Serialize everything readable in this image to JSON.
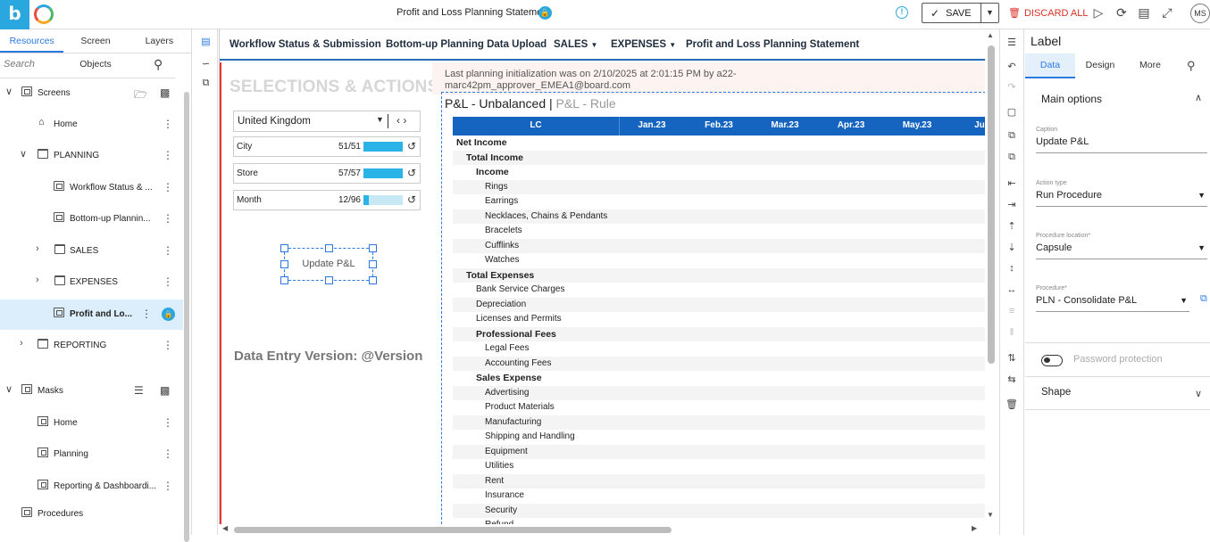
{
  "topbar": {
    "title": "Profit and Loss Planning Statement",
    "save_label": "SAVE",
    "discard_label": "DISCARD ALL",
    "user_initials": "MS",
    "icons": [
      "play-icon",
      "refresh-icon",
      "screen-icon",
      "expand-icon"
    ]
  },
  "left": {
    "tabs": [
      "Resources",
      "Screen Objects",
      "Layers"
    ],
    "search_placeholder": "Search",
    "screens_header": "Screens",
    "tree": [
      {
        "label": "Home",
        "level": 1
      },
      {
        "label": "PLANNING",
        "level": 1
      },
      {
        "label": "Workflow Status & ...",
        "level": 2
      },
      {
        "label": "Bottom-up Plannin...",
        "level": 2
      },
      {
        "label": "SALES",
        "level": 2
      },
      {
        "label": "EXPENSES",
        "level": 2
      },
      {
        "label": "Profit and Lo...",
        "level": 2
      },
      {
        "label": "REPORTING",
        "level": 0
      }
    ],
    "masks_header": "Masks",
    "masks": [
      "Home",
      "Planning",
      "Reporting & Dashboardi..."
    ],
    "procedures": "Procedures"
  },
  "canvas": {
    "menu": [
      "Workflow Status & Submission",
      "Bottom-up Planning Data Upload",
      "SALES",
      "EXPENSES",
      "Profit and Loss Planning Statement"
    ],
    "selections_title": "SELECTIONS & ACTIONS",
    "dropdown_value": "United Kingdom",
    "selectors": [
      {
        "name": "City",
        "count": "51/51",
        "fill": 1.0
      },
      {
        "name": "Store",
        "count": "57/57",
        "fill": 1.0
      },
      {
        "name": "Month",
        "count": "12/96",
        "fill": 0.125
      }
    ],
    "label_text": "Update P&L",
    "data_version": "Data Entry Version: @Version",
    "init_message": "Last planning initialization was on 2/10/2025 at 2:01:15 PM by a22-marc42pm_approver_EMEA1@board.com",
    "grid_title": "P&L - Unbalanced",
    "grid_title_sep": "|",
    "grid_subtitle": "P&L - Rule",
    "grid_headers": [
      "LC",
      "Jan.23",
      "Feb.23",
      "Mar.23",
      "Apr.23",
      "May.23",
      "Jun"
    ],
    "grid_rows": [
      {
        "label": "Net Income",
        "indent": 0,
        "bold": true
      },
      {
        "label": "Total Income",
        "indent": 1,
        "bold": true
      },
      {
        "label": "Income",
        "indent": 2,
        "bold": true
      },
      {
        "label": "Rings",
        "indent": 3,
        "bold": false
      },
      {
        "label": "Earrings",
        "indent": 3,
        "bold": false
      },
      {
        "label": "Necklaces, Chains & Pendants",
        "indent": 3,
        "bold": false
      },
      {
        "label": "Bracelets",
        "indent": 3,
        "bold": false
      },
      {
        "label": "Cufflinks",
        "indent": 3,
        "bold": false
      },
      {
        "label": "Watches",
        "indent": 3,
        "bold": false
      },
      {
        "label": "Total Expenses",
        "indent": 1,
        "bold": true
      },
      {
        "label": "Bank Service Charges",
        "indent": 2,
        "bold": false
      },
      {
        "label": "Depreciation",
        "indent": 2,
        "bold": false
      },
      {
        "label": "Licenses and Permits",
        "indent": 2,
        "bold": false
      },
      {
        "label": "Professional Fees",
        "indent": 2,
        "bold": true
      },
      {
        "label": "Legal Fees",
        "indent": 3,
        "bold": false
      },
      {
        "label": "Accounting Fees",
        "indent": 3,
        "bold": false
      },
      {
        "label": "Sales Expense",
        "indent": 2,
        "bold": true
      },
      {
        "label": "Advertising",
        "indent": 3,
        "bold": false
      },
      {
        "label": "Product Materials",
        "indent": 3,
        "bold": false
      },
      {
        "label": "Manufacturing",
        "indent": 3,
        "bold": false
      },
      {
        "label": "Shipping and Handling",
        "indent": 3,
        "bold": false
      },
      {
        "label": "Equipment",
        "indent": 3,
        "bold": false
      },
      {
        "label": "Utilities",
        "indent": 3,
        "bold": false
      },
      {
        "label": "Rent",
        "indent": 3,
        "bold": false
      },
      {
        "label": "Insurance",
        "indent": 3,
        "bold": false
      },
      {
        "label": "Security",
        "indent": 3,
        "bold": false
      },
      {
        "label": "Refund",
        "indent": 3,
        "bold": false
      }
    ]
  },
  "props": {
    "title": "Label",
    "tabs": [
      "Data",
      "Design",
      "More"
    ],
    "section_main": "Main options",
    "caption_label": "Caption",
    "caption_value": "Update P&L",
    "action_type_label": "Action type",
    "action_type_value": "Run Procedure",
    "procedure_location_label": "Procedure location*",
    "procedure_location_value": "Capsule",
    "procedure_label": "Procedure*",
    "procedure_value": "PLN - Consolidate P&L",
    "password_label": "Password protection",
    "section_shape": "Shape"
  },
  "colors": {
    "accent": "#2a7ae2",
    "header_blue": "#1565c0",
    "selector_fill": "#2ab3e6",
    "discard_red": "#d93025"
  }
}
